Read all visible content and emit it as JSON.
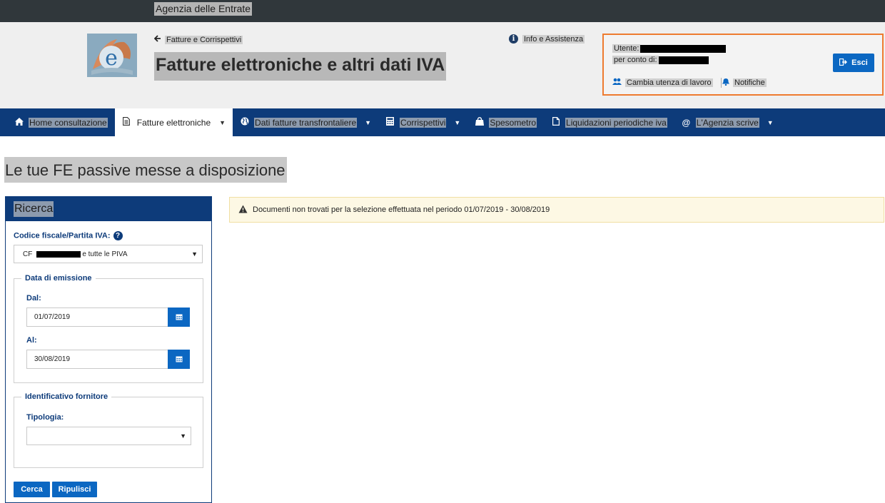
{
  "topbar": {
    "agency": "Agenzia delle Entrate"
  },
  "header": {
    "back_label": "Fatture e Corrispettivi",
    "title": "Fatture elettroniche e altri dati IVA",
    "info_label": "Info e Assistenza",
    "user_label": "Utente:",
    "on_behalf_label": "per conto di:",
    "logout_label": "Esci",
    "change_user_label": "Cambia utenza di lavoro",
    "notifications_label": "Notifiche"
  },
  "nav": {
    "items": [
      {
        "label": "Home consultazione",
        "icon": "home-icon"
      },
      {
        "label": "Fatture elettroniche",
        "icon": "document-icon"
      },
      {
        "label": "Dati fatture transfrontaliere",
        "icon": "globe-icon"
      },
      {
        "label": "Corrispettivi",
        "icon": "calculator-icon"
      },
      {
        "label": "Spesometro",
        "icon": "shopping-bag-icon"
      },
      {
        "label": "Liquidazioni periodiche iva",
        "icon": "file-icon"
      },
      {
        "label": "L'Agenzia scrive",
        "icon": "at-icon"
      }
    ]
  },
  "page": {
    "heading": "Le tue FE passive messe a disposizione"
  },
  "search": {
    "title": "Ricerca",
    "cf_label": "Codice fiscale/Partita IVA:",
    "cf_prefix": "CF",
    "cf_suffix": "e tutte le PIVA",
    "date_group_label": "Data di emissione",
    "from_label": "Dal:",
    "from_value": "01/07/2019",
    "to_label": "Al:",
    "to_value": "30/08/2019",
    "supplier_group_label": "Identificativo fornitore",
    "type_label": "Tipologia:",
    "type_value": "",
    "search_button": "Cerca",
    "clear_button": "Ripulisci"
  },
  "alert": {
    "message": "Documenti non trovati per la selezione effettuata nel periodo 01/07/2019 - 30/08/2019"
  },
  "colors": {
    "nav_bg": "#0d3b7a",
    "button_bg": "#0b67c2",
    "highlight_border": "#ee7b2f",
    "alert_bg": "#fdf8e4"
  }
}
